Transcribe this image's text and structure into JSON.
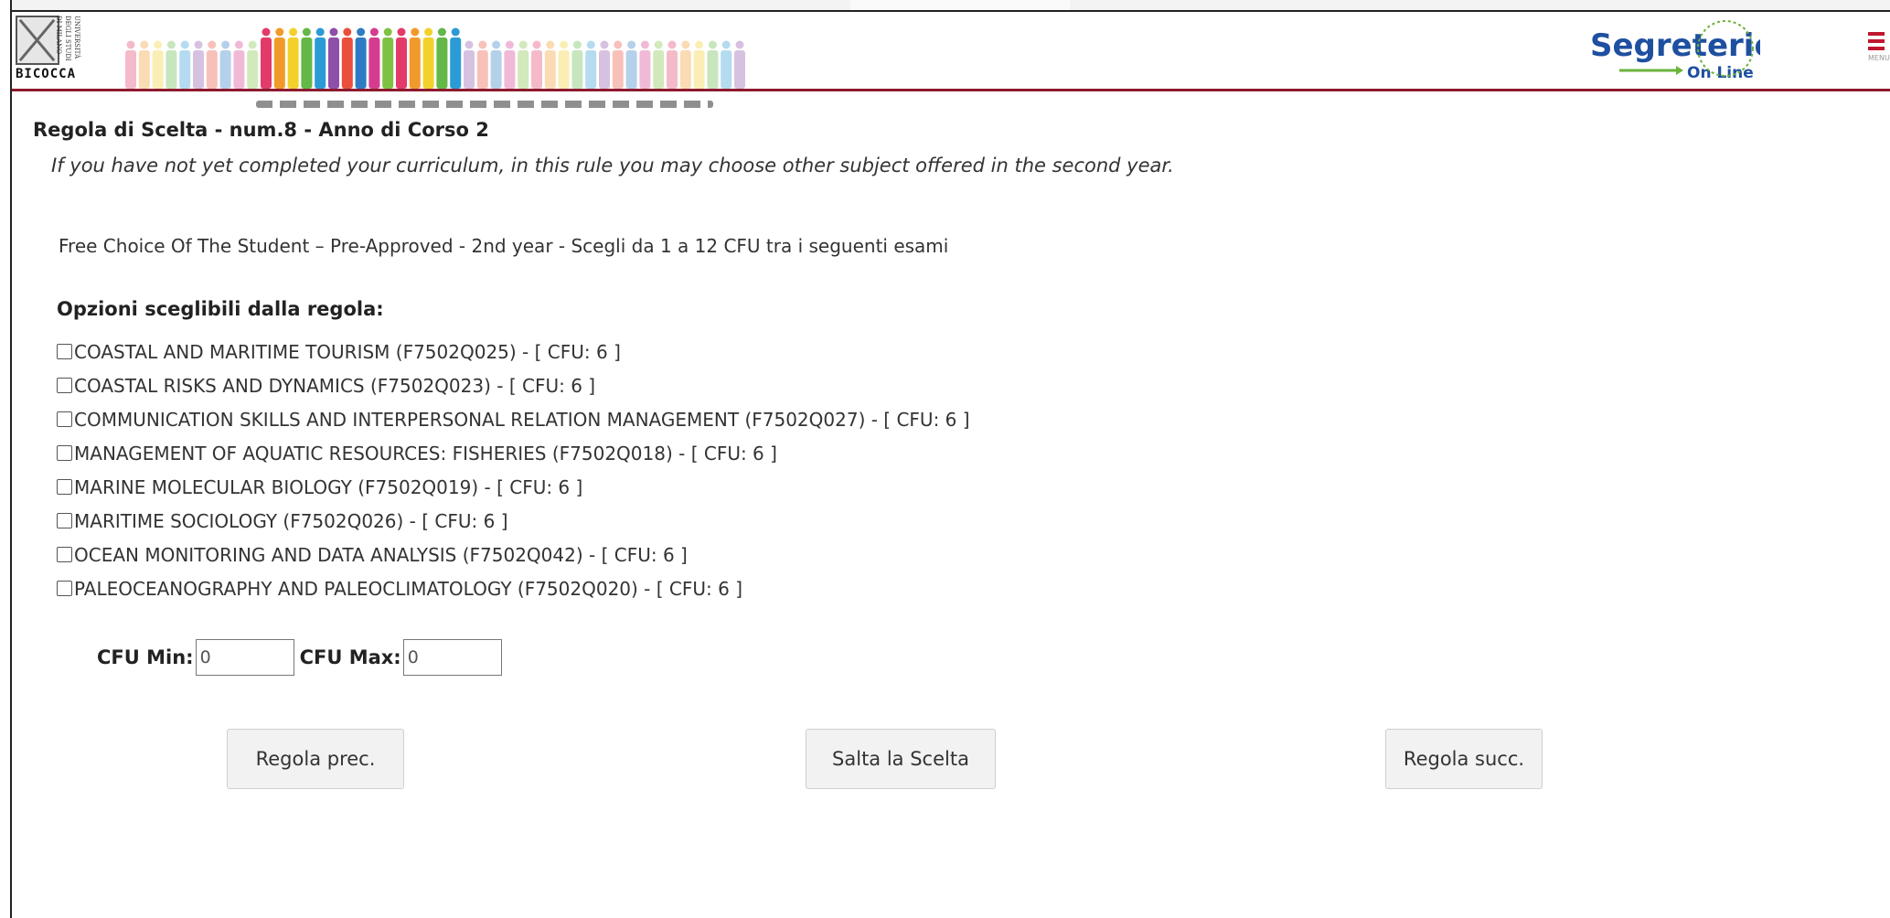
{
  "header": {
    "university_name": "BICOCCA",
    "university_vertical_text": "UNIVERSITÀ DEGLI STUDI DI MILANO",
    "brand_title": "Segreterie",
    "brand_subtitle": "On Line",
    "menu_label": "MENU",
    "colors": {
      "accent": "#8d1a2e",
      "brand_blue": "#1e4fa0",
      "brand_green": "#6bb33a",
      "menu_red": "#c0172e"
    }
  },
  "rule": {
    "title": "Regola di Scelta - num.8 - Anno di Corso 2",
    "description": "If you have not yet completed your curriculum, in this rule you may choose other subject offered in the second year.",
    "summary": "Free Choice Of The Student – Pre-Approved - 2nd year - Scegli da 1 a 12 CFU tra i seguenti esami"
  },
  "options": {
    "title": "Opzioni sceglibili dalla regola:",
    "items": [
      {
        "label": "COASTAL AND MARITIME TOURISM (F7502Q025) - [ CFU: 6 ]",
        "checked": false
      },
      {
        "label": "COASTAL RISKS AND DYNAMICS (F7502Q023) - [ CFU: 6 ]",
        "checked": false
      },
      {
        "label": "COMMUNICATION SKILLS AND INTERPERSONAL RELATION MANAGEMENT (F7502Q027) - [ CFU: 6 ]",
        "checked": false
      },
      {
        "label": "MANAGEMENT OF AQUATIC RESOURCES: FISHERIES (F7502Q018) - [ CFU: 6 ]",
        "checked": false
      },
      {
        "label": "MARINE MOLECULAR BIOLOGY (F7502Q019) - [ CFU: 6 ]",
        "checked": false
      },
      {
        "label": "MARITIME SOCIOLOGY (F7502Q026) - [ CFU: 6 ]",
        "checked": false
      },
      {
        "label": "OCEAN MONITORING AND DATA ANALYSIS (F7502Q042) - [ CFU: 6 ]",
        "checked": false
      },
      {
        "label": "PALEOCEANOGRAPHY AND PALEOCLIMATOLOGY (F7502Q020) - [ CFU: 6 ]",
        "checked": false
      }
    ]
  },
  "cfu": {
    "min_label": "CFU Min:",
    "min_value": "0",
    "max_label": "CFU Max:",
    "max_value": "0"
  },
  "buttons": {
    "prev": "Regola prec.",
    "skip": "Salta la Scelta",
    "next": "Regola succ."
  }
}
